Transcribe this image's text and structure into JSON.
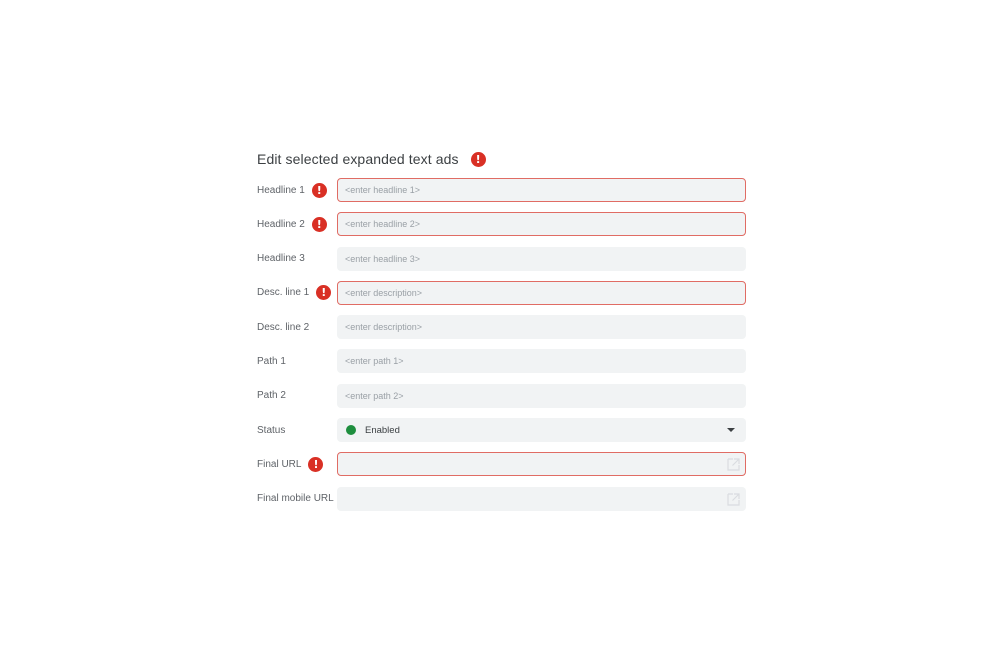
{
  "form": {
    "title": "Edit selected expanded text ads",
    "title_has_error": true,
    "error_icon_glyph": "!",
    "fields": [
      {
        "label": "Headline 1",
        "placeholder": "<enter headline 1>",
        "value": "",
        "error": true
      },
      {
        "label": "Headline 2",
        "placeholder": "<enter headline 2>",
        "value": "",
        "error": true
      },
      {
        "label": "Headline 3",
        "placeholder": "<enter headline 3>",
        "value": "",
        "error": false
      },
      {
        "label": "Desc. line 1",
        "placeholder": "<enter description>",
        "value": "",
        "error": true
      },
      {
        "label": "Desc. line 2",
        "placeholder": "<enter description>",
        "value": "",
        "error": false
      },
      {
        "label": "Path 1",
        "placeholder": "<enter path 1>",
        "value": "",
        "error": false
      },
      {
        "label": "Path 2",
        "placeholder": "<enter path 2>",
        "value": "",
        "error": false
      }
    ],
    "status": {
      "label": "Status",
      "value": "Enabled",
      "color": "#1e8e3e",
      "icon": "chevron-down-icon"
    },
    "final_url": {
      "label": "Final URL",
      "value": "",
      "error": true,
      "icon": "open-in-new-icon"
    },
    "final_mobile_url": {
      "label": "Final mobile URL",
      "value": "",
      "error": false,
      "icon": "open-in-new-icon"
    }
  },
  "colors": {
    "error": "#d93025",
    "error_border": "#e06c64",
    "field_bg": "#f1f3f4",
    "enabled": "#1e8e3e"
  }
}
